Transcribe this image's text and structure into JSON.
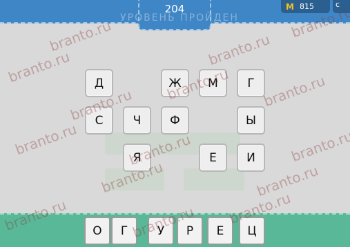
{
  "header": {
    "level": "204",
    "title_ghost": "УРОВЕНЬ ПРОЙДЕН",
    "coins": "815",
    "coin_icon": "М"
  },
  "letters": [
    "Д",
    "Ж",
    "М",
    "Г",
    "С",
    "Ч",
    "Ф",
    "Ы",
    "Я",
    "Е",
    "И"
  ],
  "answer": [
    "О",
    "Г",
    "У",
    "Р",
    "Е",
    "Ц"
  ],
  "watermark": "branto.ru",
  "colors": {
    "topbar": "#3f86c7",
    "answerbar": "#58b898",
    "background": "#d9d9d9",
    "coin": "#f4c21f"
  }
}
